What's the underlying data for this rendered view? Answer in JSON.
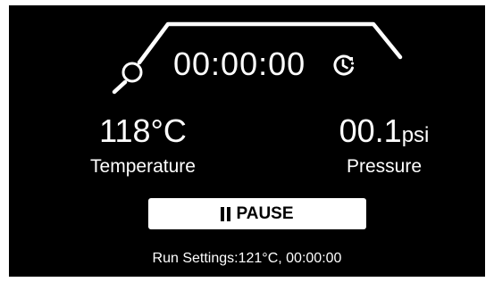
{
  "timer": {
    "elapsed": "00:00:00"
  },
  "temperature": {
    "value": "118°C",
    "label": "Temperature"
  },
  "pressure": {
    "value": "00.1",
    "unit": "psi",
    "label": "Pressure"
  },
  "pause_button": {
    "label": "PAUSE"
  },
  "run_settings": {
    "label": "Run Settings:",
    "values": "121°C, 00:00:00"
  },
  "icons": {
    "cycle_indicator": "cycle-progress-indicator-icon",
    "clock": "clock-icon",
    "pause": "pause-icon"
  },
  "colors": {
    "background": "#000000",
    "foreground": "#ffffff",
    "button_text": "#000000"
  }
}
